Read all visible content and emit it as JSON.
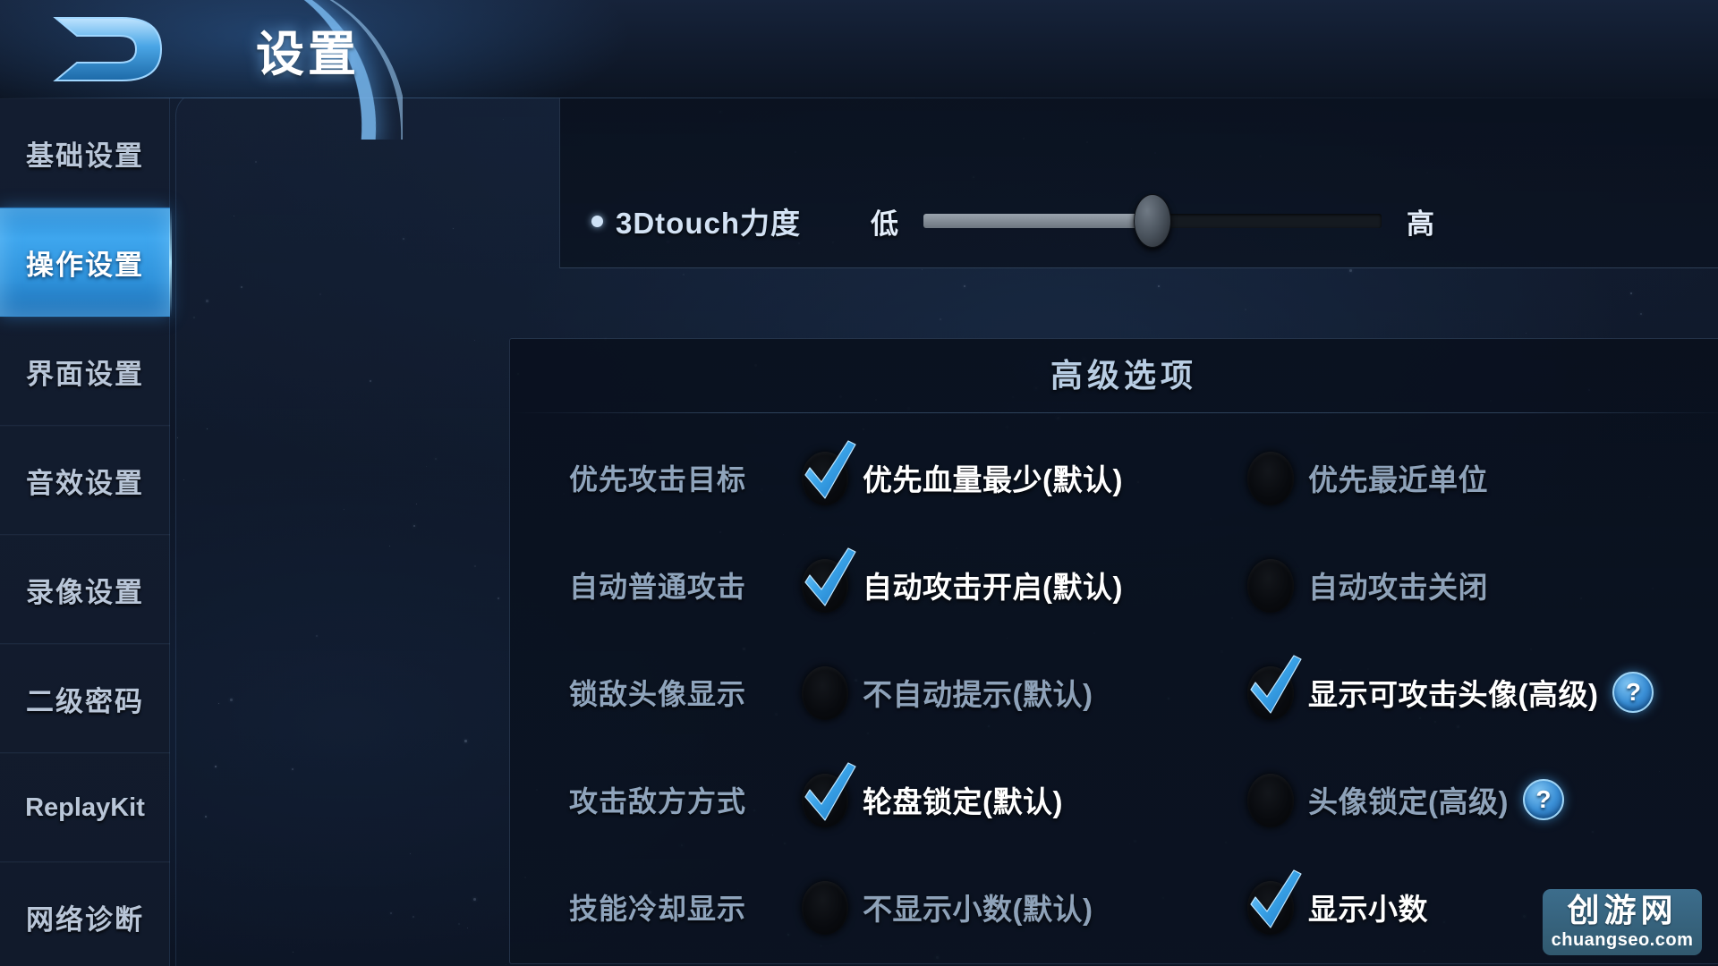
{
  "header": {
    "title": "设置",
    "logo_icon": "game-logo-icon"
  },
  "sidebar": {
    "items": [
      {
        "label": "基础设置",
        "active": false,
        "latin": false
      },
      {
        "label": "操作设置",
        "active": true,
        "latin": false
      },
      {
        "label": "界面设置",
        "active": false,
        "latin": false
      },
      {
        "label": "音效设置",
        "active": false,
        "latin": false
      },
      {
        "label": "录像设置",
        "active": false,
        "latin": false
      },
      {
        "label": "二级密码",
        "active": false,
        "latin": false
      },
      {
        "label": "ReplayKit",
        "active": false,
        "latin": true
      },
      {
        "label": "网络诊断",
        "active": false,
        "latin": false
      }
    ]
  },
  "touch_setting": {
    "label": "3Dtouch力度",
    "low_label": "低",
    "high_label": "高",
    "value_percent": 50
  },
  "advanced": {
    "title": "高级选项",
    "help_glyph": "?",
    "rows": [
      {
        "label": "优先攻击目标",
        "left": {
          "text": "优先血量最少(默认)",
          "selected": true,
          "help": false
        },
        "right": {
          "text": "优先最近单位",
          "selected": false,
          "help": false
        }
      },
      {
        "label": "自动普通攻击",
        "left": {
          "text": "自动攻击开启(默认)",
          "selected": true,
          "help": false
        },
        "right": {
          "text": "自动攻击关闭",
          "selected": false,
          "help": false
        }
      },
      {
        "label": "锁敌头像显示",
        "left": {
          "text": "不自动提示(默认)",
          "selected": false,
          "help": false
        },
        "right": {
          "text": "显示可攻击头像(高级)",
          "selected": true,
          "help": true
        }
      },
      {
        "label": "攻击敌方方式",
        "left": {
          "text": "轮盘锁定(默认)",
          "selected": true,
          "help": false
        },
        "right": {
          "text": "头像锁定(高级)",
          "selected": false,
          "help": true
        }
      },
      {
        "label": "技能冷却显示",
        "left": {
          "text": "不显示小数(默认)",
          "selected": false,
          "help": false
        },
        "right": {
          "text": "显示小数",
          "selected": true,
          "help": false
        }
      }
    ]
  },
  "watermark": {
    "cn": "创游网",
    "en": "chuangseo.com"
  },
  "colors": {
    "accent_blue": "#3ea6ee",
    "check_blue": "#3aa3e8",
    "panel_bg": "#0b1321",
    "text_muted": "#8fa4bc",
    "text_bright": "#ffffff"
  }
}
